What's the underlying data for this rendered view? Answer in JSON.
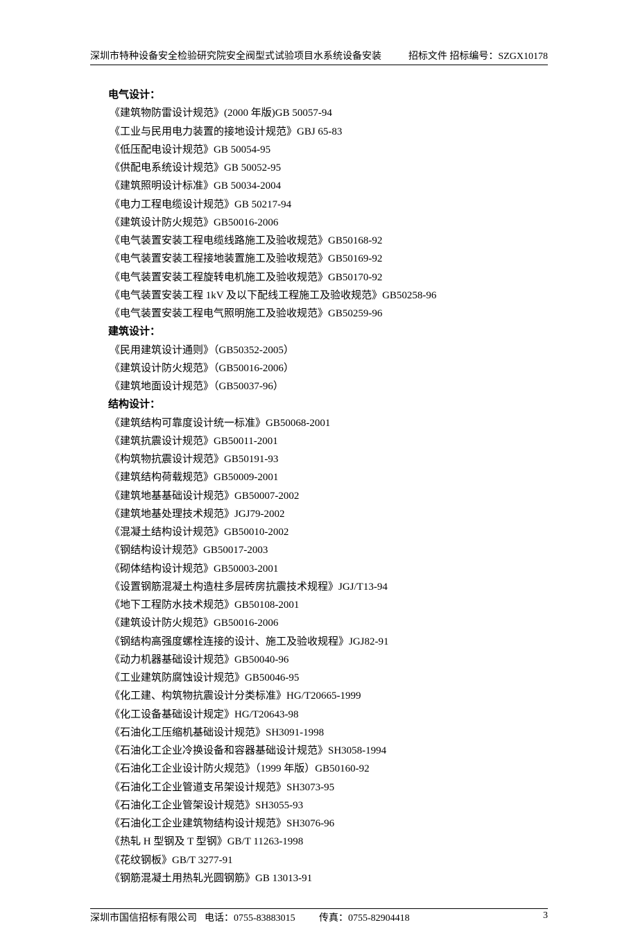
{
  "header": {
    "left": "深圳市特种设备安全检验研究院安全阀型式试验项目水系统设备安装",
    "right": "招标文件 招标编号：SZGX10178"
  },
  "sections": [
    {
      "title": "电气设计：",
      "items": [
        "《建筑物防雷设计规范》(2000 年版)GB 50057-94",
        "《工业与民用电力装置的接地设计规范》GBJ 65-83",
        "《低压配电设计规范》GB 50054-95",
        "《供配电系统设计规范》GB 50052-95",
        "《建筑照明设计标准》GB 50034-2004",
        "《电力工程电缆设计规范》GB 50217-94",
        "《建筑设计防火规范》GB50016-2006",
        "《电气装置安装工程电缆线路施工及验收规范》GB50168-92",
        "《电气装置安装工程接地装置施工及验收规范》GB50169-92",
        "《电气装置安装工程旋转电机施工及验收规范》GB50170-92",
        "《电气装置安装工程 1kV 及以下配线工程施工及验收规范》GB50258-96",
        "《电气装置安装工程电气照明施工及验收规范》GB50259-96"
      ]
    },
    {
      "title": "建筑设计：",
      "items": [
        "《民用建筑设计通则》（GB50352-2005）",
        "《建筑设计防火规范》（GB50016-2006）",
        "《建筑地面设计规范》（GB50037-96）"
      ]
    },
    {
      "title": "结构设计：",
      "items": [
        "《建筑结构可靠度设计统一标准》GB50068-2001",
        "《建筑抗震设计规范》GB50011-2001",
        "《构筑物抗震设计规范》GB50191-93",
        "《建筑结构荷载规范》GB50009-2001",
        "《建筑地基基础设计规范》GB50007-2002",
        "《建筑地基处理技术规范》JGJ79-2002",
        "《混凝土结构设计规范》GB50010-2002",
        "《钢结构设计规范》GB50017-2003",
        "《砌体结构设计规范》GB50003-2001",
        "《设置钢筋混凝土构造柱多层砖房抗震技术规程》JGJ/T13-94",
        "《地下工程防水技术规范》GB50108-2001",
        "《建筑设计防火规范》GB50016-2006",
        "《钢结构高强度螺栓连接的设计、施工及验收规程》JGJ82-91",
        "《动力机器基础设计规范》GB50040-96",
        "《工业建筑防腐蚀设计规范》GB50046-95",
        "《化工建、构筑物抗震设计分类标准》HG/T20665-1999",
        "《化工设备基础设计规定》HG/T20643-98",
        "《石油化工压缩机基础设计规范》SH3091-1998",
        "《石油化工企业冷换设备和容器基础设计规范》SH3058-1994",
        "《石油化工企业设计防火规范》（1999 年版）GB50160-92",
        "《石油化工企业管道支吊架设计规范》SH3073-95",
        "《石油化工企业管架设计规范》SH3055-93",
        "《石油化工企业建筑物结构设计规范》SH3076-96",
        "《热轧 H 型钢及 T 型钢》GB/T 11263-1998",
        "《花纹钢板》GB/T 3277-91",
        "《钢筋混凝土用热轧光圆钢筋》GB 13013-91"
      ]
    }
  ],
  "footer": {
    "company": "深圳市国信招标有限公司",
    "phone": "电话：0755-83883015",
    "fax": "传真：0755-82904418",
    "page": "3"
  }
}
